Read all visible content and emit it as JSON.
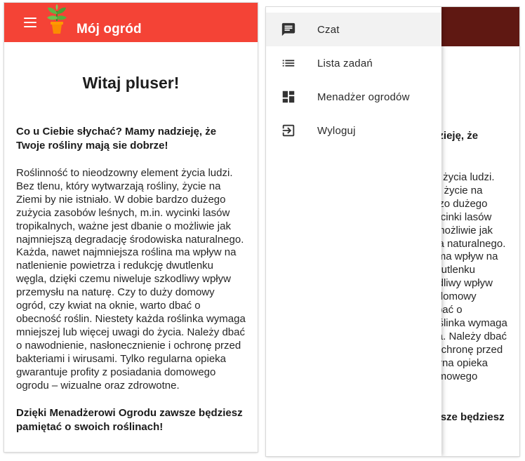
{
  "app": {
    "title": "Mój ogród"
  },
  "main": {
    "greeting": "Witaj pluser!",
    "lead": "Co u Ciebie słychać? Mamy nadzieję, że Twoje rośliny mają sie dobrze!",
    "body": "Roślinność to nieodzowny element życia ludzi. Bez tlenu, który wytwarzają rośliny, życie na Ziemi by nie istniało. W dobie bardzo dużego zużycia zasobów leśnych, m.in. wycinki lasów tropikalnych, ważne jest dbanie o możliwie jak najmniejszą degradację środowiska naturalnego. Każda, nawet najmniejsza roślina ma wpływ na natlenienie powietrza i redukcję dwutlenku węgla, dzięki czemu niweluje szkodliwy wpływ przemysłu na naturę. Czy to duży domowy ogród, czy kwiat na oknie, warto dbać o obecność roślin. Niestety każda roślinka wymaga mniejszej lub więcej uwagi do życia. Należy dbać o nawodnienie, nasłonecznienie i ochronę przed bakteriami i wirusami. Tylko regularna opieka gwarantuje profity z posiadania domowego ogrodu – wizualne oraz zdrowotne.",
    "closing": "Dzięki Menadżerowi Ogrodu zawsze będziesz pamiętać o swoich roślinach!"
  },
  "drawer": {
    "items": [
      {
        "label": "Czat",
        "icon": "chat-icon"
      },
      {
        "label": "Lista zadań",
        "icon": "list-icon"
      },
      {
        "label": "Menadżer ogrodów",
        "icon": "dashboard-icon"
      },
      {
        "label": "Wyloguj",
        "icon": "logout-icon"
      }
    ]
  },
  "colors": {
    "appbar": "#f44336",
    "appbar_dimmed": "#5f1812"
  }
}
